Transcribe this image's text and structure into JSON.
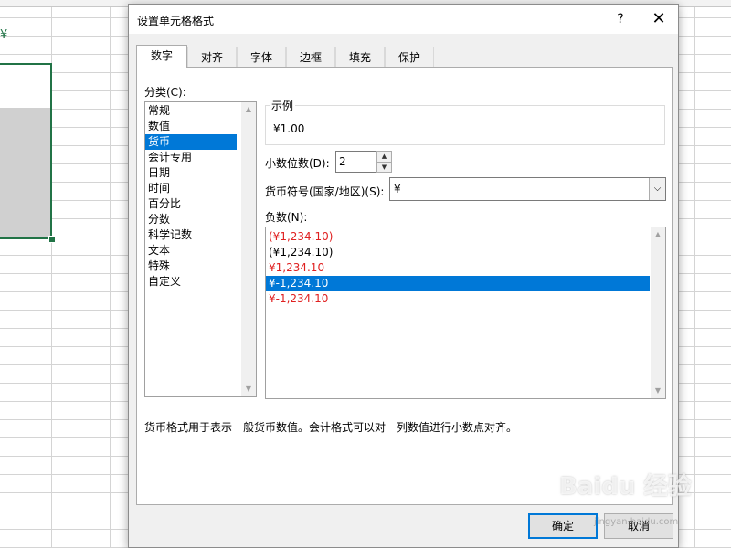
{
  "sheet": {
    "fragment": "¥"
  },
  "dialog": {
    "title": "设置单元格格式",
    "help": "?",
    "close": "✕",
    "tabs": [
      "数字",
      "对齐",
      "字体",
      "边框",
      "填充",
      "保护"
    ],
    "active_tab": "数字",
    "category_label": "分类(C):",
    "categories": [
      "常规",
      "数值",
      "货币",
      "会计专用",
      "日期",
      "时间",
      "百分比",
      "分数",
      "科学记数",
      "文本",
      "特殊",
      "自定义"
    ],
    "selected_category": "货币",
    "sample_label": "示例",
    "sample_value": "¥1.00",
    "decimal_label": "小数位数(D):",
    "decimal_value": "2",
    "symbol_label": "货币符号(国家/地区)(S):",
    "symbol_value": "¥",
    "negative_label": "负数(N):",
    "negatives": [
      {
        "text": "(¥1,234.10)",
        "color": "#e02020"
      },
      {
        "text": "(¥1,234.10)",
        "color": "#000000"
      },
      {
        "text": "¥1,234.10",
        "color": "#e02020"
      },
      {
        "text": "¥-1,234.10",
        "color": "#ffffff"
      },
      {
        "text": "¥-1,234.10",
        "color": "#e02020"
      }
    ],
    "selected_negative_index": 3,
    "description": "货币格式用于表示一般货币数值。会计格式可以对一列数值进行小数点对齐。",
    "ok": "确定",
    "cancel": "取消"
  },
  "watermark": {
    "text": "Baidu 经验",
    "sub": "jingyan.baidu.com"
  },
  "colors": {
    "accent": "#0078d7",
    "negative_red": "#e02020",
    "excel_green": "#217346"
  }
}
